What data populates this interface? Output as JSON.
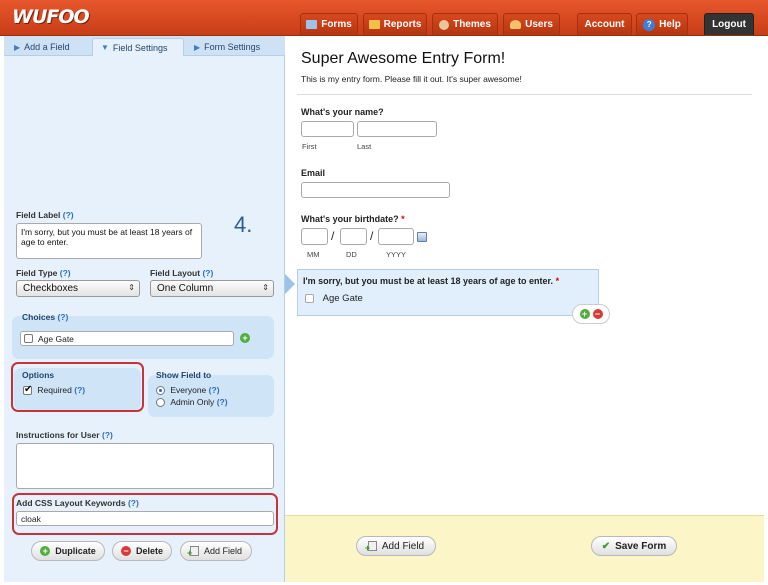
{
  "app": {
    "logo": "WUFOO"
  },
  "nav": {
    "forms": "Forms",
    "reports": "Reports",
    "themes": "Themes",
    "users": "Users",
    "account": "Account",
    "help": "Help",
    "logout": "Logout",
    "help_glyph": "?"
  },
  "left_tabs": {
    "add_field": "Add a Field",
    "field_settings": "Field Settings",
    "form_settings": "Form Settings"
  },
  "step_marker": "4.",
  "field_settings": {
    "field_label_title": "Field Label",
    "field_label_value": "I'm sorry, but you must be at least 18 years of age to enter.",
    "field_type_title": "Field Type",
    "field_type_value": "Checkboxes",
    "field_layout_title": "Field Layout",
    "field_layout_value": "One Column",
    "choices_title": "Choices",
    "choice_1": "Age Gate",
    "options_title": "Options",
    "required_label": "Required",
    "show_field_title": "Show Field to",
    "everyone_label": "Everyone",
    "admin_only_label": "Admin Only",
    "instructions_title": "Instructions for User",
    "instructions_value": "",
    "css_title": "Add CSS Layout Keywords",
    "css_value": "cloak",
    "help_link": "(?)"
  },
  "left_buttons": {
    "duplicate": "Duplicate",
    "delete": "Delete",
    "add_field": "Add Field"
  },
  "form": {
    "title": "Super Awesome Entry Form!",
    "description": "This is my entry form. Please fill it out. It's super awesome!",
    "name_label": "What's your name?",
    "first_sub": "First",
    "last_sub": "Last",
    "email_label": "Email",
    "birthdate_label": "What's your birthdate?",
    "mm_sub": "MM",
    "dd_sub": "DD",
    "yyyy_sub": "YYYY",
    "date_sep": "/",
    "required_star": "*",
    "age_question": "I'm sorry, but you must be at least 18 years of age to enter.",
    "age_choice": "Age Gate"
  },
  "bottom": {
    "add_field": "Add Field",
    "save_form": "Save Form"
  },
  "colors": {
    "topbar": "#d9481d",
    "left_panel": "#e6f1fb",
    "highlight_box": "#c7333b",
    "bottom_bar": "#fbf5c8"
  }
}
